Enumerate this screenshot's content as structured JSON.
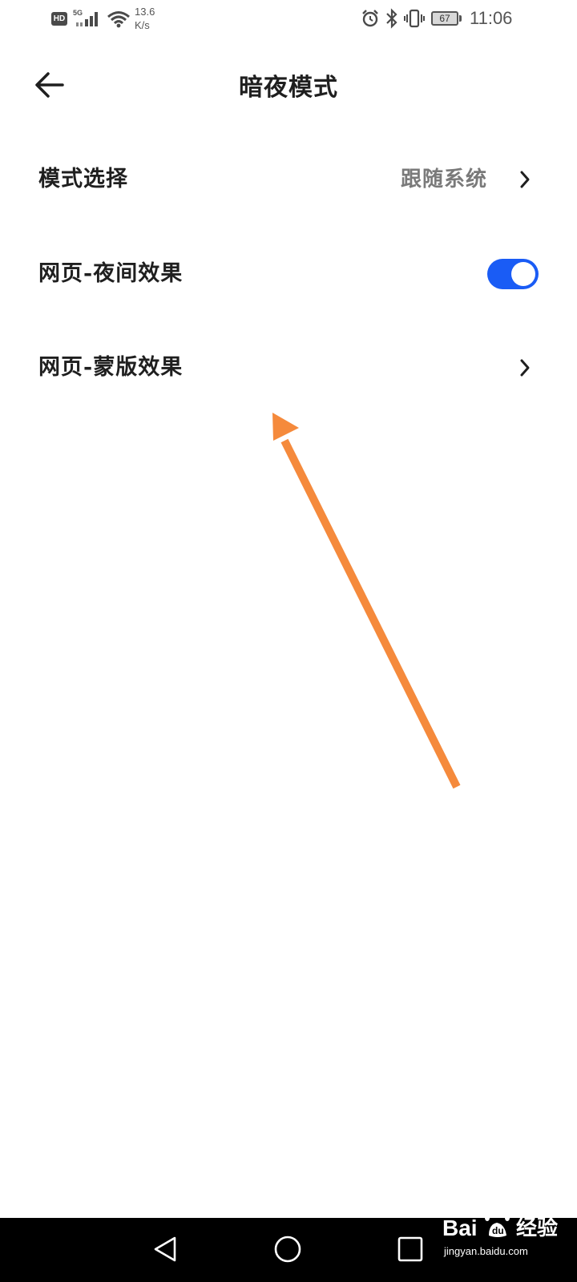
{
  "status_bar": {
    "hd_badge": "HD",
    "network_type": "5G",
    "speed_value": "13.6",
    "speed_unit": "K/s",
    "battery_level": "67",
    "time": "11:06",
    "icons": [
      "hd-icon",
      "signal-icon",
      "wifi-icon",
      "alarm-icon",
      "bluetooth-icon",
      "vibrate-icon",
      "battery-icon"
    ]
  },
  "header": {
    "title": "暗夜模式",
    "back_icon": "arrow-left-icon"
  },
  "settings": {
    "rows": [
      {
        "label": "模式选择",
        "value": "跟随系统",
        "control": "chevron"
      },
      {
        "label": "网页-夜间效果",
        "control": "toggle",
        "toggle_on": true
      },
      {
        "label": "网页-蒙版效果",
        "control": "chevron"
      }
    ]
  },
  "annotation": {
    "type": "arrow",
    "color": "#f58a3c"
  },
  "nav_bar": {
    "buttons": [
      "nav-back-icon",
      "nav-home-icon",
      "nav-recent-icon"
    ]
  },
  "watermark": {
    "logo_text": "Bai du",
    "suffix": "经验",
    "url": "jingyan.baidu.com"
  },
  "colors": {
    "accent": "#1a5cf5",
    "arrow": "#f58a3c",
    "text_primary": "#1f1f1f",
    "text_secondary": "#7a7a7a",
    "nav_background": "#000000"
  }
}
